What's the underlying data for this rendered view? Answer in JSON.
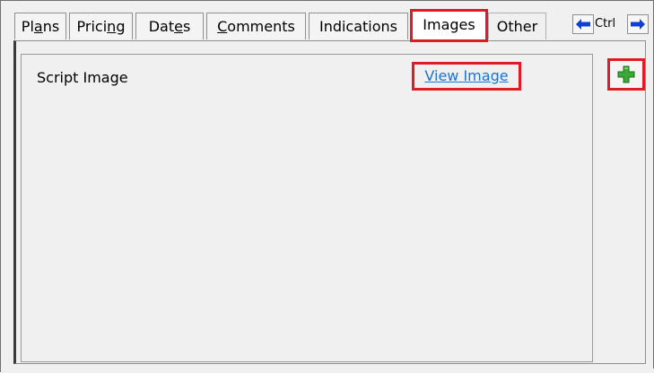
{
  "tabs": {
    "plans": {
      "pre": "Pl",
      "u": "a",
      "post": "ns"
    },
    "pricing": {
      "pre": "Prici",
      "u": "n",
      "post": "g"
    },
    "dates": {
      "pre": "Dat",
      "u": "e",
      "post": "s"
    },
    "comments": {
      "pre": "",
      "u": "C",
      "post": "omments"
    },
    "indications": "Indications",
    "images": "Images",
    "other": "Other"
  },
  "nav": {
    "ctrl_label": "Ctrl",
    "prev_icon": "left-arrow-icon",
    "next_icon": "right-arrow-icon"
  },
  "panel": {
    "rows": [
      {
        "label": "Script Image",
        "link": "View Image"
      }
    ],
    "add_icon": "green-plus-icon"
  },
  "colors": {
    "highlight": "#e01b24",
    "link": "#1a73d9",
    "nav_arrow": "#0b3fd6",
    "plus_green": "#3aa935"
  }
}
